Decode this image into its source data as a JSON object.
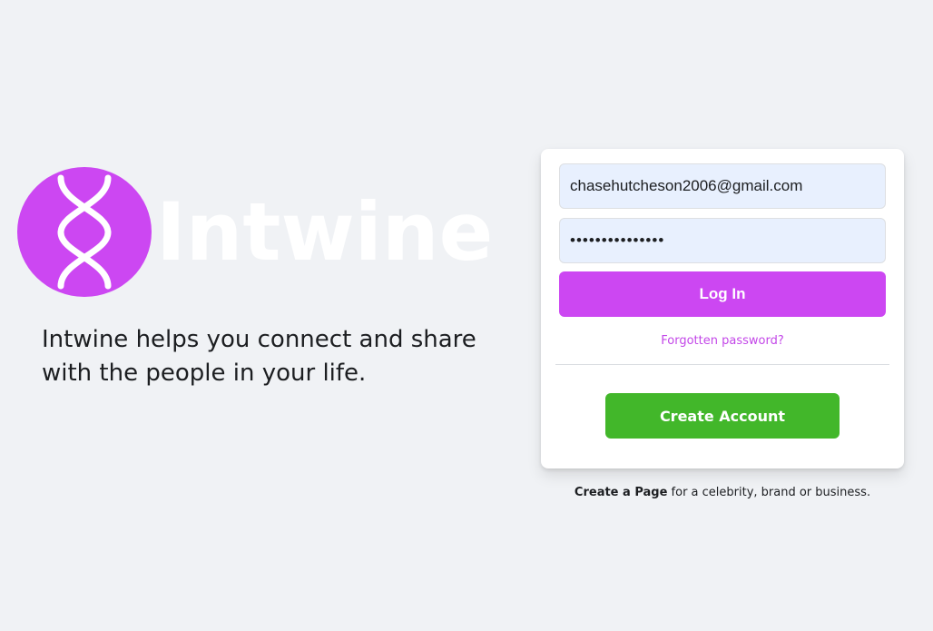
{
  "brand": {
    "name": "Intwine",
    "tagline": "Intwine helps you connect and share with the people in your life.",
    "logo_icon": "dna-helix-icon",
    "accent_color": "#cc47f2"
  },
  "login": {
    "email_value": "chasehutcheson2006@gmail.com",
    "password_value": "•••••••••••••••",
    "login_label": "Log In",
    "forgot_label": "Forgotten password?",
    "create_account_label": "Create Account",
    "create_account_color": "#42b72a"
  },
  "footer": {
    "create_page_link": "Create a Page",
    "create_page_rest": " for a celebrity, brand or business."
  }
}
